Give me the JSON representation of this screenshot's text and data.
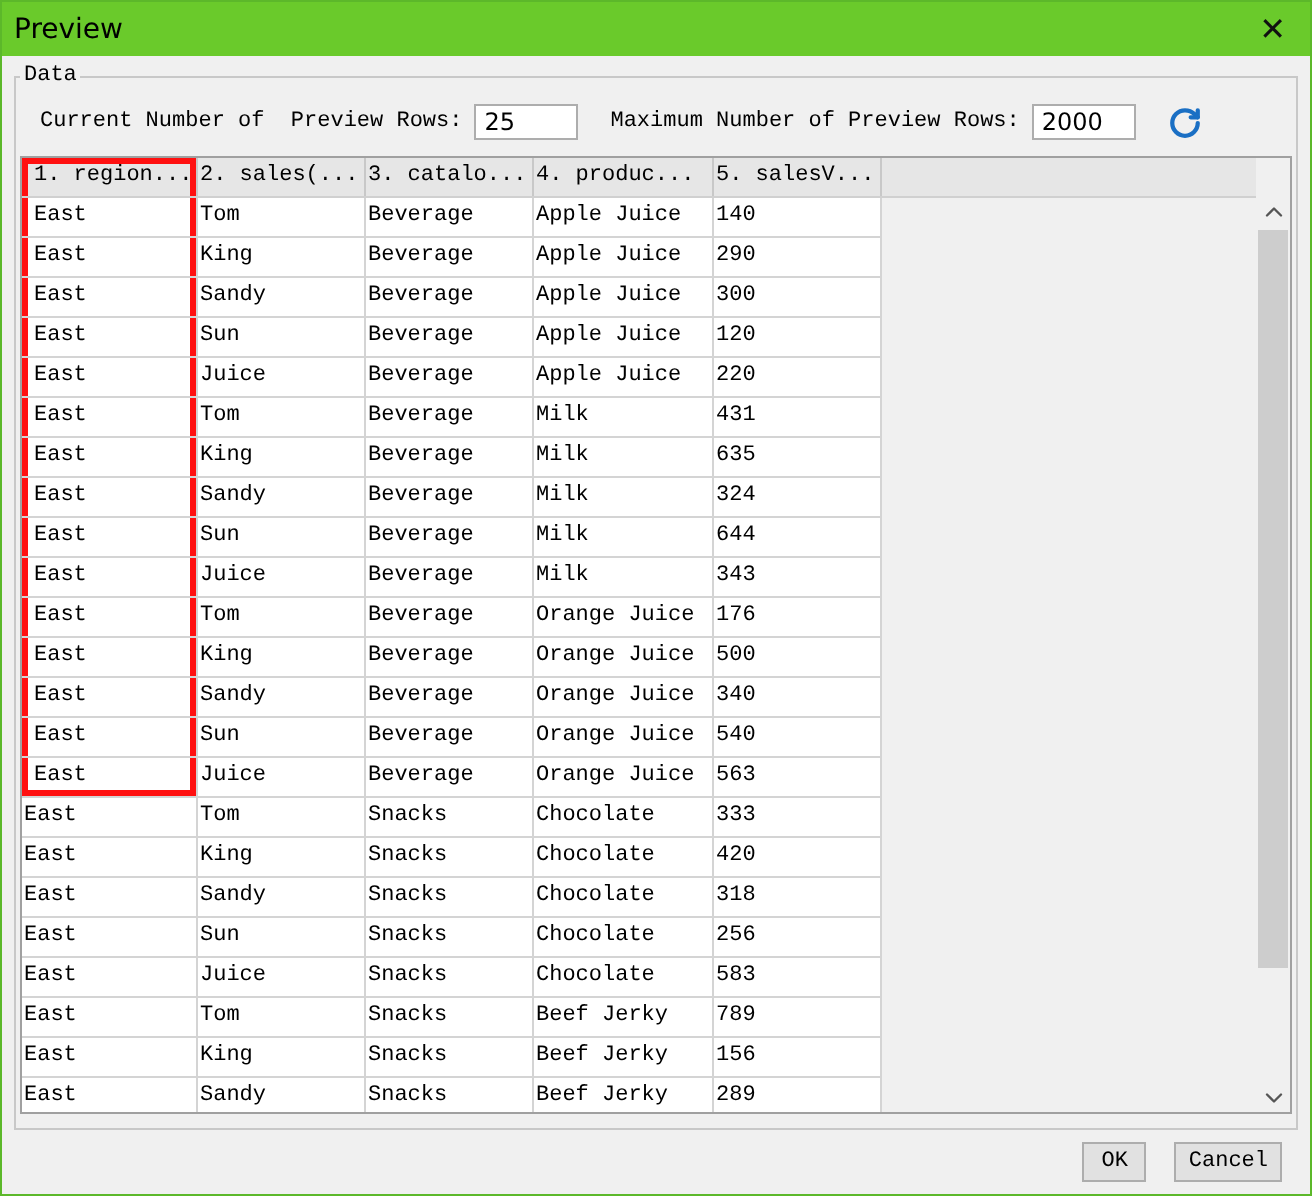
{
  "window": {
    "title": "Preview",
    "close": "✕"
  },
  "group": {
    "title": "Data"
  },
  "controls": [
    {
      "label": "Current Number of  Preview Rows:",
      "value": "25"
    },
    {
      "label": "Maximum Number of Preview Rows:",
      "value": "2000"
    }
  ],
  "table": {
    "columns": [
      {
        "label": "1. region...",
        "highlighted": true
      },
      {
        "label": "2. sales(...",
        "highlighted": false
      },
      {
        "label": "3. catalo...",
        "highlighted": false
      },
      {
        "label": "4. produc...",
        "highlighted": false
      },
      {
        "label": "5. salesV...",
        "highlighted": false
      }
    ],
    "rows": [
      {
        "cells": [
          "East",
          "Tom",
          "Beverage",
          "Apple Juice",
          "140"
        ],
        "highlighted": true
      },
      {
        "cells": [
          "East",
          "King",
          "Beverage",
          "Apple Juice",
          "290"
        ],
        "highlighted": true
      },
      {
        "cells": [
          "East",
          "Sandy",
          "Beverage",
          "Apple Juice",
          "300"
        ],
        "highlighted": true
      },
      {
        "cells": [
          "East",
          "Sun",
          "Beverage",
          "Apple Juice",
          "120"
        ],
        "highlighted": true
      },
      {
        "cells": [
          "East",
          "Juice",
          "Beverage",
          "Apple Juice",
          "220"
        ],
        "highlighted": true
      },
      {
        "cells": [
          "East",
          "Tom",
          "Beverage",
          "Milk",
          "431"
        ],
        "highlighted": true
      },
      {
        "cells": [
          "East",
          "King",
          "Beverage",
          "Milk",
          "635"
        ],
        "highlighted": true
      },
      {
        "cells": [
          "East",
          "Sandy",
          "Beverage",
          "Milk",
          "324"
        ],
        "highlighted": true
      },
      {
        "cells": [
          "East",
          "Sun",
          "Beverage",
          "Milk",
          "644"
        ],
        "highlighted": true
      },
      {
        "cells": [
          "East",
          "Juice",
          "Beverage",
          "Milk",
          "343"
        ],
        "highlighted": true
      },
      {
        "cells": [
          "East",
          "Tom",
          "Beverage",
          "Orange Juice",
          "176"
        ],
        "highlighted": true
      },
      {
        "cells": [
          "East",
          "King",
          "Beverage",
          "Orange Juice",
          "500"
        ],
        "highlighted": true
      },
      {
        "cells": [
          "East",
          "Sandy",
          "Beverage",
          "Orange Juice",
          "340"
        ],
        "highlighted": true
      },
      {
        "cells": [
          "East",
          "Sun",
          "Beverage",
          "Orange Juice",
          "540"
        ],
        "highlighted": true
      },
      {
        "cells": [
          "East",
          "Juice",
          "Beverage",
          "Orange Juice",
          "563"
        ],
        "highlighted": true
      },
      {
        "cells": [
          "East",
          "Tom",
          "Snacks",
          "Chocolate",
          "333"
        ],
        "highlighted": false
      },
      {
        "cells": [
          "East",
          "King",
          "Snacks",
          "Chocolate",
          "420"
        ],
        "highlighted": false
      },
      {
        "cells": [
          "East",
          "Sandy",
          "Snacks",
          "Chocolate",
          "318"
        ],
        "highlighted": false
      },
      {
        "cells": [
          "East",
          "Sun",
          "Snacks",
          "Chocolate",
          "256"
        ],
        "highlighted": false
      },
      {
        "cells": [
          "East",
          "Juice",
          "Snacks",
          "Chocolate",
          "583"
        ],
        "highlighted": false
      },
      {
        "cells": [
          "East",
          "Tom",
          "Snacks",
          "Beef Jerky",
          "789"
        ],
        "highlighted": false
      },
      {
        "cells": [
          "East",
          "King",
          "Snacks",
          "Beef Jerky",
          "156"
        ],
        "highlighted": false
      },
      {
        "cells": [
          "East",
          "Sandy",
          "Snacks",
          "Beef Jerky",
          "289"
        ],
        "highlighted": false
      }
    ]
  },
  "buttons": [
    "OK",
    "Cancel"
  ]
}
